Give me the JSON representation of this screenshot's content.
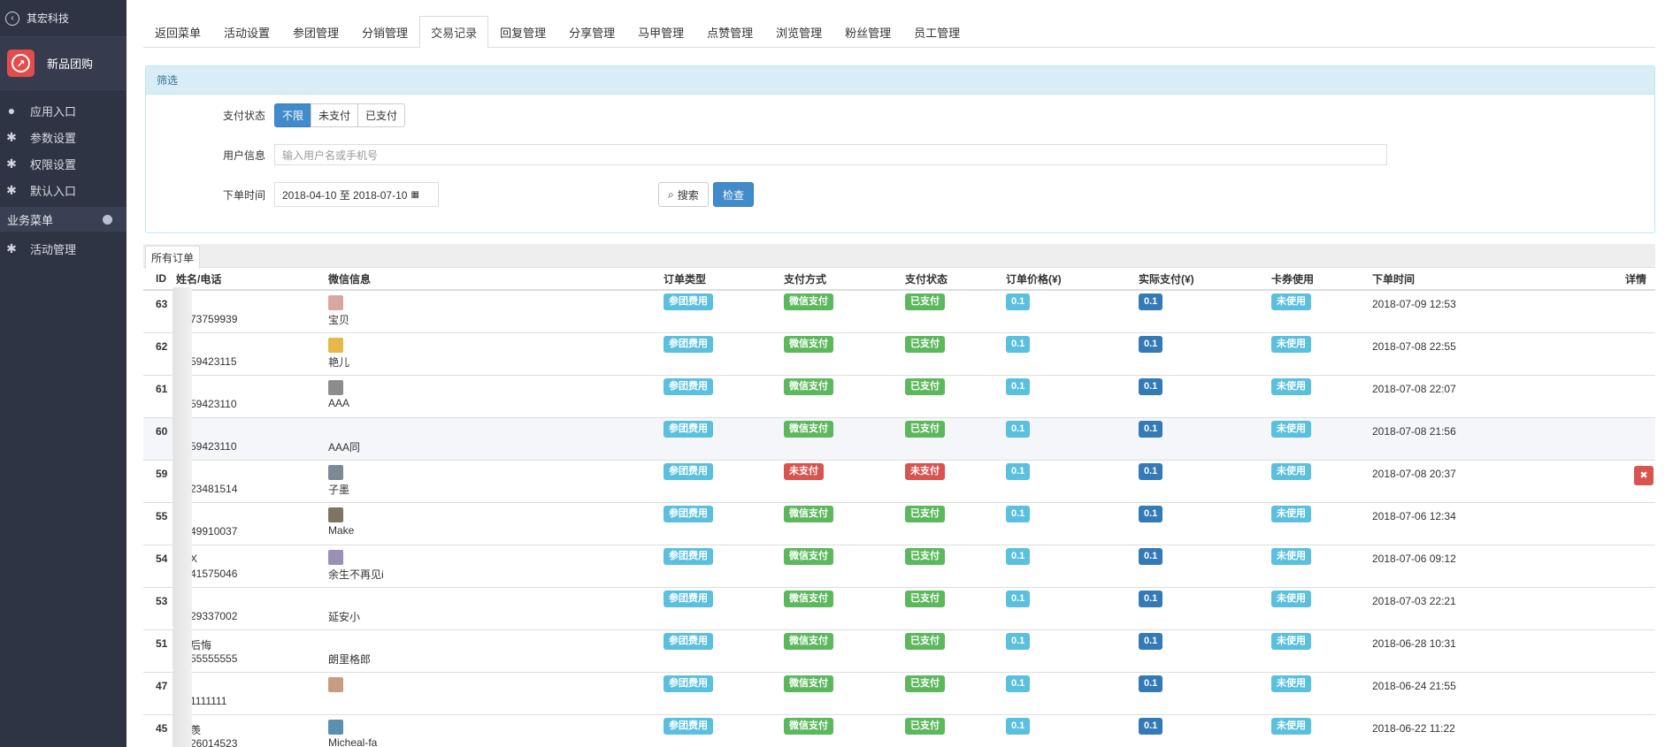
{
  "sidebar": {
    "back_label": "其宏科技",
    "app_name": "新品团购",
    "items": [
      {
        "label": "应用入口",
        "icon": "comment-icon"
      },
      {
        "label": "参数设置",
        "icon": "gear-icon"
      },
      {
        "label": "权限设置",
        "icon": "gear-icon"
      },
      {
        "label": "默认入口",
        "icon": "gear-icon"
      }
    ],
    "section_label": "业务菜单",
    "section_items": [
      {
        "label": "活动管理",
        "icon": "gear-icon"
      }
    ]
  },
  "tabs": [
    "返回菜单",
    "活动设置",
    "参团管理",
    "分销管理",
    "交易记录",
    "回复管理",
    "分享管理",
    "马甲管理",
    "点赞管理",
    "浏览管理",
    "粉丝管理",
    "员工管理"
  ],
  "active_tab": "交易记录",
  "filter": {
    "title": "筛选",
    "pay_status_label": "支付状态",
    "pay_status_options": [
      "不限",
      "未支付",
      "已支付"
    ],
    "pay_status_selected": "不限",
    "user_info_label": "用户信息",
    "user_info_placeholder": "输入用户名或手机号",
    "order_time_label": "下单时间",
    "date_range": "2018-04-10 至 2018-07-10",
    "search_label": "搜索",
    "check_label": "检查"
  },
  "orders_tab_label": "所有订单",
  "table": {
    "headers": [
      "ID",
      "姓名/电话",
      "微信信息",
      "订单类型",
      "支付方式",
      "支付状态",
      "订单价格(¥)",
      "实际支付(¥)",
      "卡券使用",
      "下单时间",
      "详情"
    ],
    "rows": [
      {
        "id": "63",
        "name": "",
        "phone": "73759939",
        "wx_name": "宝贝",
        "avatar_color": "#d9a7a0",
        "type": "参团费用",
        "pay_method": "微信支付",
        "pay_status": "已支付",
        "paid": true,
        "price": "0.1",
        "actual": "0.1",
        "coupon": "未使用",
        "time": "2018-07-09 12:53"
      },
      {
        "id": "62",
        "name": "",
        "phone": "59423115",
        "wx_name": "艳儿",
        "avatar_color": "#e6b84a",
        "type": "参团费用",
        "pay_method": "微信支付",
        "pay_status": "已支付",
        "paid": true,
        "price": "0.1",
        "actual": "0.1",
        "coupon": "未使用",
        "time": "2018-07-08 22:55"
      },
      {
        "id": "61",
        "name": "",
        "phone": "59423110",
        "wx_name": "AAA",
        "avatar_color": "#8c8c8c",
        "type": "参团费用",
        "pay_method": "微信支付",
        "pay_status": "已支付",
        "paid": true,
        "price": "0.1",
        "actual": "0.1",
        "coupon": "未使用",
        "time": "2018-07-08 22:07"
      },
      {
        "id": "60",
        "name": "",
        "phone": "59423110",
        "wx_name": "AAA同",
        "avatar_color": "",
        "type": "参团费用",
        "pay_method": "微信支付",
        "pay_status": "已支付",
        "paid": true,
        "price": "0.1",
        "actual": "0.1",
        "coupon": "未使用",
        "time": "2018-07-08 21:56"
      },
      {
        "id": "59",
        "name": "",
        "phone": "23481514",
        "wx_name": "子墨",
        "avatar_color": "#7a8a99",
        "type": "参团费用",
        "pay_method": "未支付",
        "pay_status": "未支付",
        "paid": false,
        "price": "0.1",
        "actual": "0.1",
        "coupon": "未使用",
        "time": "2018-07-08 20:37"
      },
      {
        "id": "55",
        "name": "",
        "phone": "49910037",
        "wx_name": "Make",
        "avatar_color": "#7d7560",
        "type": "参团费用",
        "pay_method": "微信支付",
        "pay_status": "已支付",
        "paid": true,
        "price": "0.1",
        "actual": "0.1",
        "coupon": "未使用",
        "time": "2018-07-06 12:34"
      },
      {
        "id": "54",
        "name": "X",
        "phone": "41575046",
        "wx_name": "余生不再见i",
        "avatar_color": "#9a8fb5",
        "type": "参团费用",
        "pay_method": "微信支付",
        "pay_status": "已支付",
        "paid": true,
        "price": "0.1",
        "actual": "0.1",
        "coupon": "未使用",
        "time": "2018-07-06 09:12"
      },
      {
        "id": "53",
        "name": "",
        "phone": "29337002",
        "wx_name": "延安小",
        "avatar_color": "",
        "type": "参团费用",
        "pay_method": "微信支付",
        "pay_status": "已支付",
        "paid": true,
        "price": "0.1",
        "actual": "0.1",
        "coupon": "未使用",
        "time": "2018-07-03 22:21"
      },
      {
        "id": "51",
        "name": "后悔",
        "phone": "55555555",
        "wx_name": "朗里格郎",
        "avatar_color": "",
        "type": "参团费用",
        "pay_method": "微信支付",
        "pay_status": "已支付",
        "paid": true,
        "price": "0.1",
        "actual": "0.1",
        "coupon": "未使用",
        "time": "2018-06-28 10:31"
      },
      {
        "id": "47",
        "name": "",
        "phone": "1111111",
        "wx_name": "",
        "avatar_color": "#c79c84",
        "type": "参团费用",
        "pay_method": "微信支付",
        "pay_status": "已支付",
        "paid": true,
        "price": "0.1",
        "actual": "0.1",
        "coupon": "未使用",
        "time": "2018-06-24 21:55"
      },
      {
        "id": "45",
        "name": "羡",
        "phone": "26014523",
        "wx_name": "Micheal-fa",
        "avatar_color": "#5a8fb0",
        "type": "参团费用",
        "pay_method": "微信支付",
        "pay_status": "已支付",
        "paid": true,
        "price": "0.1",
        "actual": "0.1",
        "coupon": "未使用",
        "time": "2018-06-22 11:22"
      }
    ]
  }
}
